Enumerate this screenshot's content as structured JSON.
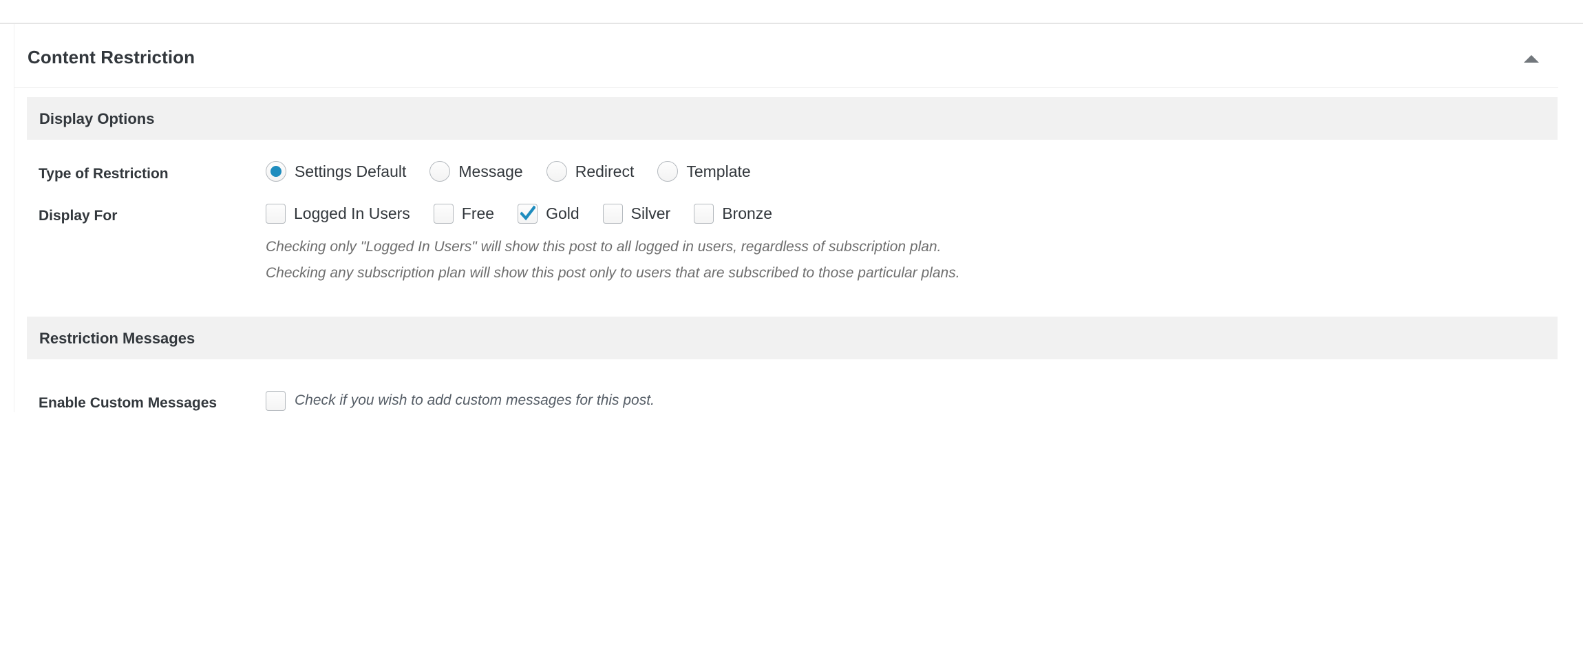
{
  "panel": {
    "title": "Content Restriction",
    "collapse_icon": "caret-up-icon"
  },
  "sections": {
    "display_options": {
      "heading": "Display Options",
      "type_of_restriction": {
        "label": "Type of Restriction",
        "options": [
          {
            "label": "Settings Default",
            "checked": true
          },
          {
            "label": "Message",
            "checked": false
          },
          {
            "label": "Redirect",
            "checked": false
          },
          {
            "label": "Template",
            "checked": false
          }
        ]
      },
      "display_for": {
        "label": "Display For",
        "options": [
          {
            "label": "Logged In Users",
            "checked": false
          },
          {
            "label": "Free",
            "checked": false
          },
          {
            "label": "Gold",
            "checked": true
          },
          {
            "label": "Silver",
            "checked": false
          },
          {
            "label": "Bronze",
            "checked": false
          }
        ],
        "help": [
          "Checking only \"Logged In Users\" will show this post to all logged in users, regardless of subscription plan.",
          "Checking any subscription plan will show this post only to users that are subscribed to those particular plans."
        ]
      }
    },
    "restriction_messages": {
      "heading": "Restriction Messages",
      "enable_custom_messages": {
        "label": "Enable Custom Messages",
        "checked": false,
        "help": "Check if you wish to add custom messages for this post."
      }
    }
  },
  "colors": {
    "accent": "#1e8cbe",
    "text": "#32373c",
    "muted": "#6e6e6e",
    "section_bg": "#f1f1f1",
    "border": "#e5e5e5"
  }
}
